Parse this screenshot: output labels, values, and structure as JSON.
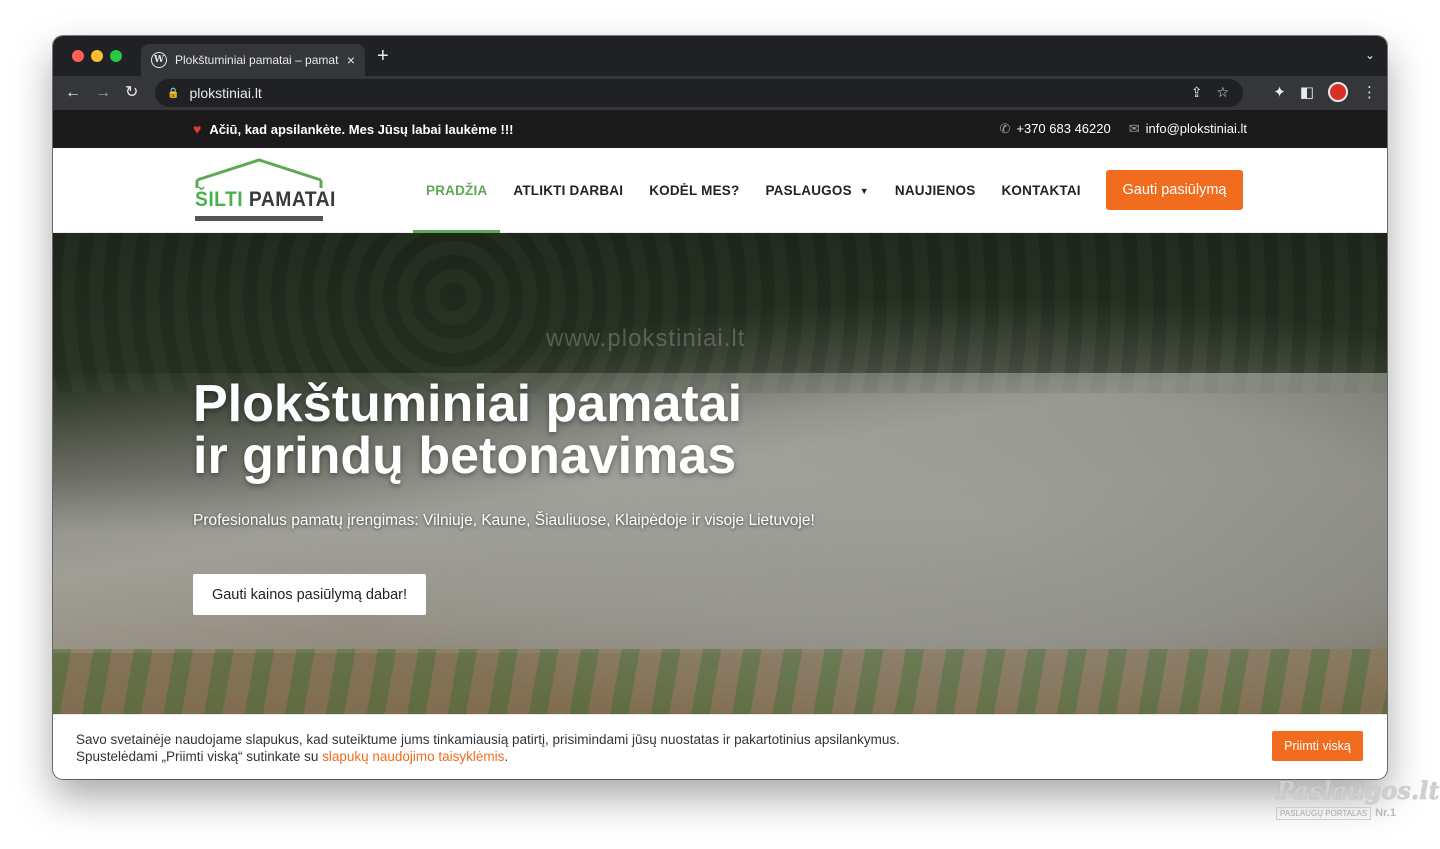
{
  "browser": {
    "tab_title": "Plokštuminiai pamatai – pamatai",
    "tab_close": "×",
    "new_tab": "+",
    "tab_menu": "⌄",
    "url": "plokstiniai.lt"
  },
  "topbar": {
    "greeting": "Ačiū, kad apsilankėte. Mes Jūsų labai laukėme !!!",
    "phone": "+370 683 46220",
    "email": "info@plokstiniai.lt"
  },
  "header": {
    "logo_text_part1": "ŠILTI",
    "logo_text_part2": "PAMATAI",
    "nav": [
      {
        "label": "PRADŽIA"
      },
      {
        "label": "ATLIKTI DARBAI"
      },
      {
        "label": "KODĖL MES?"
      },
      {
        "label": "PASLAUGOS"
      },
      {
        "label": "NAUJIENOS"
      },
      {
        "label": "KONTAKTAI"
      }
    ],
    "cta": "Gauti pasiūlymą"
  },
  "hero": {
    "watermark": "www.plokstiniai.lt",
    "title_line1": "Plokštuminiai pamatai",
    "title_line2": "ir grindų betonavimas",
    "subtitle": "Profesionalus pamatų įrengimas: Vilniuje, Kaune, Šiauliuose, Klaipėdoje ir visoje Lietuvoje!",
    "button": "Gauti kainos pasiūlymą dabar!"
  },
  "cookie": {
    "line1": "Savo svetainėje naudojame slapukus, kad suteiktume jums tinkamiausią patirtį, prisimindami jūsų nuostatas ir pakartotinius apsilankymus.",
    "line2_prefix": "Spustelėdami „Priimti viską“ sutinkate su ",
    "line2_link": "slapukų naudojimo taisyklėmis",
    "line2_suffix": ".",
    "button": "Priimti viską"
  },
  "brandmark": {
    "title": "Paslaugos.lt",
    "subtitle": "PASLAUGŲ PORTALAS",
    "rank": "Nr.1"
  }
}
